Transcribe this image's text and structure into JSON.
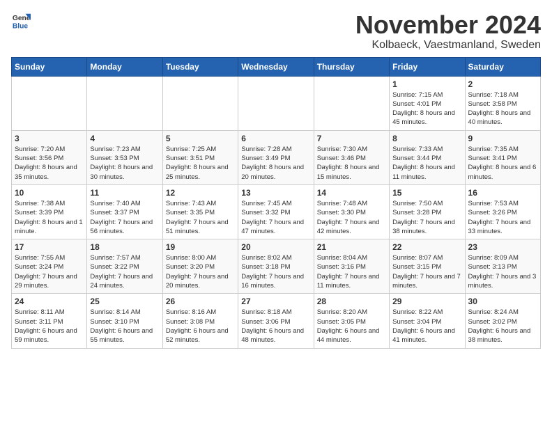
{
  "header": {
    "logo_general": "General",
    "logo_blue": "Blue",
    "title": "November 2024",
    "subtitle": "Kolbaeck, Vaestmanland, Sweden"
  },
  "days_of_week": [
    "Sunday",
    "Monday",
    "Tuesday",
    "Wednesday",
    "Thursday",
    "Friday",
    "Saturday"
  ],
  "weeks": [
    [
      {
        "day": "",
        "info": ""
      },
      {
        "day": "",
        "info": ""
      },
      {
        "day": "",
        "info": ""
      },
      {
        "day": "",
        "info": ""
      },
      {
        "day": "",
        "info": ""
      },
      {
        "day": "1",
        "info": "Sunrise: 7:15 AM\nSunset: 4:01 PM\nDaylight: 8 hours\nand 45 minutes."
      },
      {
        "day": "2",
        "info": "Sunrise: 7:18 AM\nSunset: 3:58 PM\nDaylight: 8 hours\nand 40 minutes."
      }
    ],
    [
      {
        "day": "3",
        "info": "Sunrise: 7:20 AM\nSunset: 3:56 PM\nDaylight: 8 hours\nand 35 minutes."
      },
      {
        "day": "4",
        "info": "Sunrise: 7:23 AM\nSunset: 3:53 PM\nDaylight: 8 hours\nand 30 minutes."
      },
      {
        "day": "5",
        "info": "Sunrise: 7:25 AM\nSunset: 3:51 PM\nDaylight: 8 hours\nand 25 minutes."
      },
      {
        "day": "6",
        "info": "Sunrise: 7:28 AM\nSunset: 3:49 PM\nDaylight: 8 hours\nand 20 minutes."
      },
      {
        "day": "7",
        "info": "Sunrise: 7:30 AM\nSunset: 3:46 PM\nDaylight: 8 hours\nand 15 minutes."
      },
      {
        "day": "8",
        "info": "Sunrise: 7:33 AM\nSunset: 3:44 PM\nDaylight: 8 hours\nand 11 minutes."
      },
      {
        "day": "9",
        "info": "Sunrise: 7:35 AM\nSunset: 3:41 PM\nDaylight: 8 hours\nand 6 minutes."
      }
    ],
    [
      {
        "day": "10",
        "info": "Sunrise: 7:38 AM\nSunset: 3:39 PM\nDaylight: 8 hours\nand 1 minute."
      },
      {
        "day": "11",
        "info": "Sunrise: 7:40 AM\nSunset: 3:37 PM\nDaylight: 7 hours\nand 56 minutes."
      },
      {
        "day": "12",
        "info": "Sunrise: 7:43 AM\nSunset: 3:35 PM\nDaylight: 7 hours\nand 51 minutes."
      },
      {
        "day": "13",
        "info": "Sunrise: 7:45 AM\nSunset: 3:32 PM\nDaylight: 7 hours\nand 47 minutes."
      },
      {
        "day": "14",
        "info": "Sunrise: 7:48 AM\nSunset: 3:30 PM\nDaylight: 7 hours\nand 42 minutes."
      },
      {
        "day": "15",
        "info": "Sunrise: 7:50 AM\nSunset: 3:28 PM\nDaylight: 7 hours\nand 38 minutes."
      },
      {
        "day": "16",
        "info": "Sunrise: 7:53 AM\nSunset: 3:26 PM\nDaylight: 7 hours\nand 33 minutes."
      }
    ],
    [
      {
        "day": "17",
        "info": "Sunrise: 7:55 AM\nSunset: 3:24 PM\nDaylight: 7 hours\nand 29 minutes."
      },
      {
        "day": "18",
        "info": "Sunrise: 7:57 AM\nSunset: 3:22 PM\nDaylight: 7 hours\nand 24 minutes."
      },
      {
        "day": "19",
        "info": "Sunrise: 8:00 AM\nSunset: 3:20 PM\nDaylight: 7 hours\nand 20 minutes."
      },
      {
        "day": "20",
        "info": "Sunrise: 8:02 AM\nSunset: 3:18 PM\nDaylight: 7 hours\nand 16 minutes."
      },
      {
        "day": "21",
        "info": "Sunrise: 8:04 AM\nSunset: 3:16 PM\nDaylight: 7 hours\nand 11 minutes."
      },
      {
        "day": "22",
        "info": "Sunrise: 8:07 AM\nSunset: 3:15 PM\nDaylight: 7 hours\nand 7 minutes."
      },
      {
        "day": "23",
        "info": "Sunrise: 8:09 AM\nSunset: 3:13 PM\nDaylight: 7 hours\nand 3 minutes."
      }
    ],
    [
      {
        "day": "24",
        "info": "Sunrise: 8:11 AM\nSunset: 3:11 PM\nDaylight: 6 hours\nand 59 minutes."
      },
      {
        "day": "25",
        "info": "Sunrise: 8:14 AM\nSunset: 3:10 PM\nDaylight: 6 hours\nand 55 minutes."
      },
      {
        "day": "26",
        "info": "Sunrise: 8:16 AM\nSunset: 3:08 PM\nDaylight: 6 hours\nand 52 minutes."
      },
      {
        "day": "27",
        "info": "Sunrise: 8:18 AM\nSunset: 3:06 PM\nDaylight: 6 hours\nand 48 minutes."
      },
      {
        "day": "28",
        "info": "Sunrise: 8:20 AM\nSunset: 3:05 PM\nDaylight: 6 hours\nand 44 minutes."
      },
      {
        "day": "29",
        "info": "Sunrise: 8:22 AM\nSunset: 3:04 PM\nDaylight: 6 hours\nand 41 minutes."
      },
      {
        "day": "30",
        "info": "Sunrise: 8:24 AM\nSunset: 3:02 PM\nDaylight: 6 hours\nand 38 minutes."
      }
    ]
  ]
}
